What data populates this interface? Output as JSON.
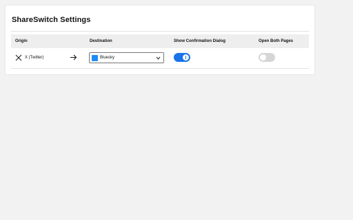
{
  "page": {
    "title": "ShareSwitch Settings"
  },
  "table": {
    "headers": {
      "origin": "Origin",
      "destination": "Destination",
      "confirm": "Show Confirmation Dialog",
      "both": "Open Both Pages"
    },
    "rows": [
      {
        "origin": "X (Twitter)",
        "origin_icon": "x-logo-icon",
        "arrow_icon": "arrow-right-icon",
        "destination": "Bluesky",
        "destination_icon": "bluesky-logo-icon",
        "show_confirmation": true,
        "open_both": false
      }
    ]
  },
  "colors": {
    "accent": "#1a73e8",
    "toggle_off": "#d6d6d6",
    "bluesky": "#1d8cf8"
  }
}
